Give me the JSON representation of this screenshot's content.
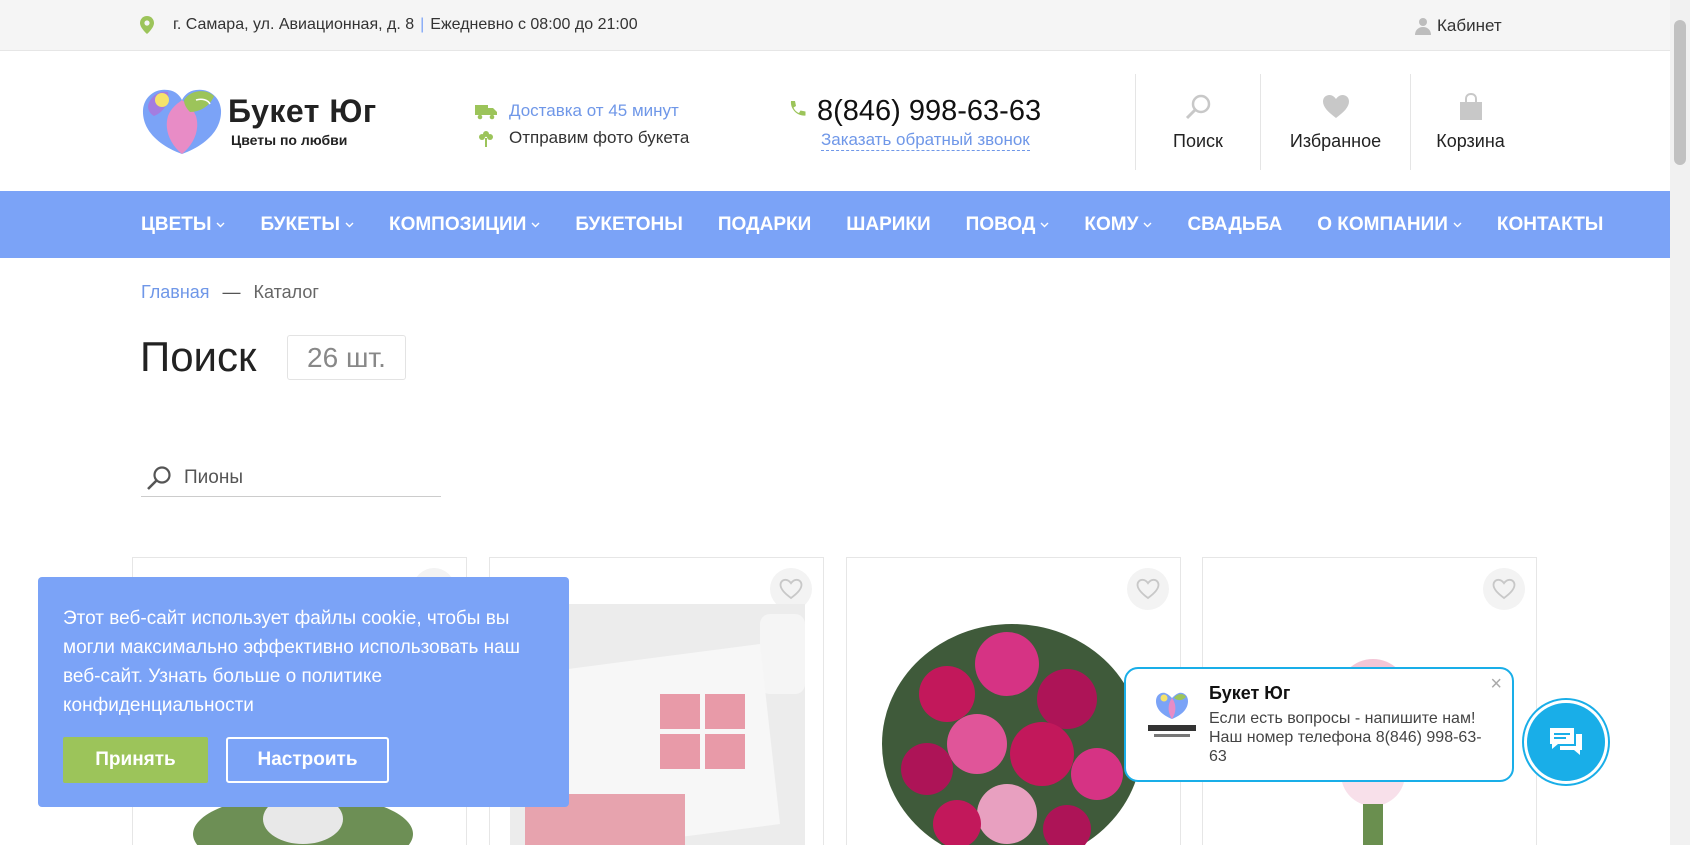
{
  "topbar": {
    "address": "г. Самара, ул. Авиационная, д. 8",
    "separator": "|",
    "hours": "Ежедневно с 08:00 до 21:00",
    "cabinet": "Кабинет"
  },
  "header": {
    "brand": "Букет Юг",
    "slogan": "Цветы по любви",
    "delivery": "Доставка от 45 минут",
    "photo": "Отправим фото букета",
    "phone": "8(846) 998-63-63",
    "callback": "Заказать обратный звонок",
    "search": "Поиск",
    "favorites": "Избранное",
    "cart": "Корзина"
  },
  "nav": {
    "items": [
      {
        "label": "ЦВЕТЫ",
        "dropdown": true
      },
      {
        "label": "БУКЕТЫ",
        "dropdown": true
      },
      {
        "label": "КОМПОЗИЦИИ",
        "dropdown": true
      },
      {
        "label": "БУКЕТОНЫ",
        "dropdown": false
      },
      {
        "label": "ПОДАРКИ",
        "dropdown": false
      },
      {
        "label": "ШАРИКИ",
        "dropdown": false
      },
      {
        "label": "ПОВОД",
        "dropdown": true
      },
      {
        "label": "КОМУ",
        "dropdown": true
      },
      {
        "label": "СВАДЬБА",
        "dropdown": false
      },
      {
        "label": "О КОМПАНИИ",
        "dropdown": true
      },
      {
        "label": "КОНТАКТЫ",
        "dropdown": false
      }
    ]
  },
  "breadcrumb": {
    "home": "Главная",
    "dash": "—",
    "current": "Каталог"
  },
  "main": {
    "title": "Поиск",
    "count": "26 шт.",
    "search_value": "Пионы"
  },
  "cookie": {
    "message": "Этот веб-сайт использует файлы cookie, чтобы вы могли максимально эффективно использовать наш веб-сайт. Узнать больше о политике конфиденциальности",
    "accept": "Принять",
    "settings": "Настроить"
  },
  "chat": {
    "close": "×",
    "name": "Букет Юг",
    "text": "Если есть вопросы - напишите нам! Наш номер телефона 8(846) 998-63-63"
  },
  "colors": {
    "accent": "#7ba3f7",
    "link": "#6f97e8",
    "green": "#9cc45a",
    "chat": "#19aee8"
  }
}
